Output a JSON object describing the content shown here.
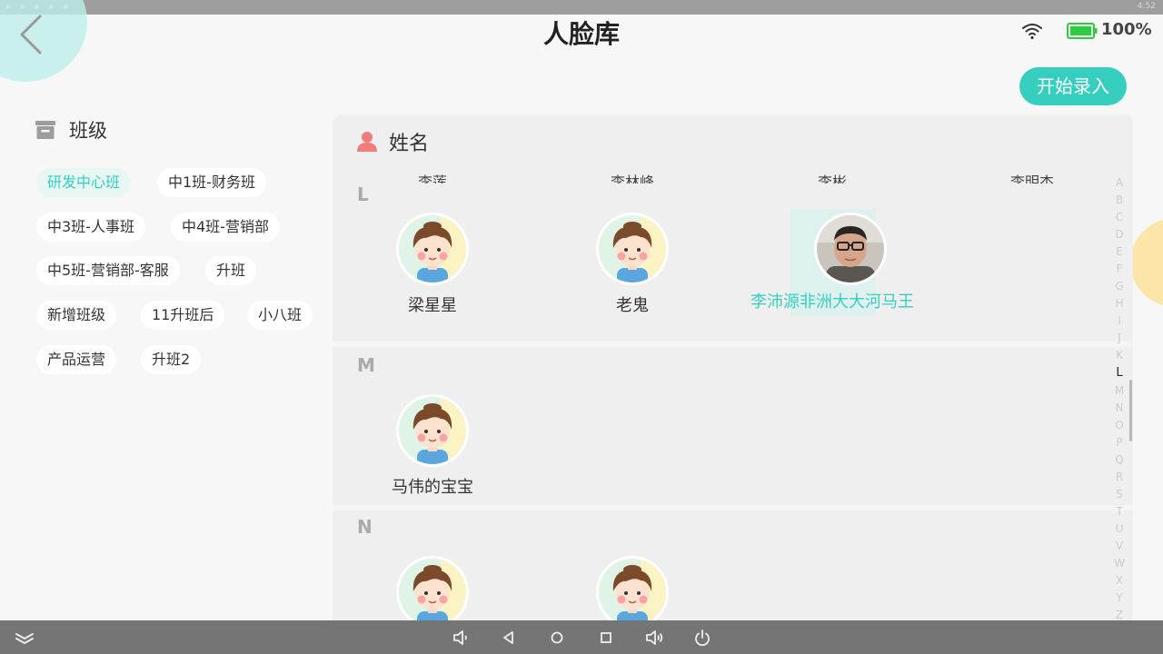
{
  "status_bar": {
    "left_icons": "▪ ▪ ▪ ▪ ▪",
    "time": "4:52"
  },
  "header": {
    "title": "人脸库",
    "battery": "100%",
    "start_button": "开始录入"
  },
  "classes": {
    "title": "班级",
    "items": [
      {
        "label": "研发中心班",
        "active": true
      },
      {
        "label": "中1班-财务班"
      },
      {
        "label": "中3班-人事班"
      },
      {
        "label": "中4班-营销部"
      },
      {
        "label": "中5班-营销部-客服"
      },
      {
        "label": "升班"
      },
      {
        "label": "新增班级"
      },
      {
        "label": "11升班后"
      },
      {
        "label": "小八班"
      },
      {
        "label": "产品运营"
      },
      {
        "label": "升班2"
      }
    ]
  },
  "names_panel": {
    "title": "姓名",
    "cutoff_names": [
      "李莲",
      "李林峰",
      "李彬",
      "李明杰"
    ],
    "groups": [
      {
        "letter": "L",
        "people": [
          "梁星星",
          "老鬼",
          "李沛源非洲大大河马王"
        ]
      },
      {
        "letter": "M",
        "people": [
          "马伟的宝宝"
        ]
      },
      {
        "letter": "N",
        "people": [
          "",
          ""
        ]
      }
    ]
  },
  "index": {
    "letters": [
      "A",
      "B",
      "C",
      "D",
      "E",
      "F",
      "G",
      "H",
      "I",
      "J",
      "K",
      "L",
      "M",
      "N",
      "O",
      "P",
      "Q",
      "R",
      "S",
      "T",
      "U",
      "V",
      "W",
      "X",
      "Y",
      "Z"
    ],
    "active": "L"
  },
  "colors": {
    "accent": "#36cfbf",
    "battery": "#2ecc40",
    "person_icon": "#f07c7c"
  }
}
